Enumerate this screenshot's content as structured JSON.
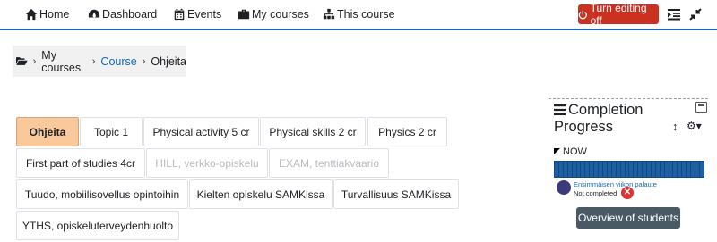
{
  "navbar": {
    "home": "Home",
    "dashboard": "Dashboard",
    "events": "Events",
    "my_courses": "My courses",
    "this_course": "This course",
    "edit_button": "Turn editing off"
  },
  "breadcrumb": {
    "items": [
      "My courses",
      "Course",
      "Ohjeita"
    ]
  },
  "tabs": {
    "items": [
      "Ohjeita",
      "Topic 1",
      "Physical activity 5 cr",
      "Physical skills 2 cr",
      "Physics 2 cr",
      "First part of studies 4cr",
      "HILL, verkko-opiskelu",
      "EXAM, tenttiakvaario",
      "Tuudo, mobiilisovellus opintoihin",
      "Kielten opiskelu SAMKissa",
      "Turvallisuus SAMKissa",
      "YTHS, opiskeluterveydenhuolto"
    ]
  },
  "completion": {
    "title": "Completion Progress",
    "now_label": "NOW",
    "activity_name": "Ensimmäisen viikon palaute",
    "activity_status": "Not completed",
    "overview_button": "Overview of students"
  }
}
